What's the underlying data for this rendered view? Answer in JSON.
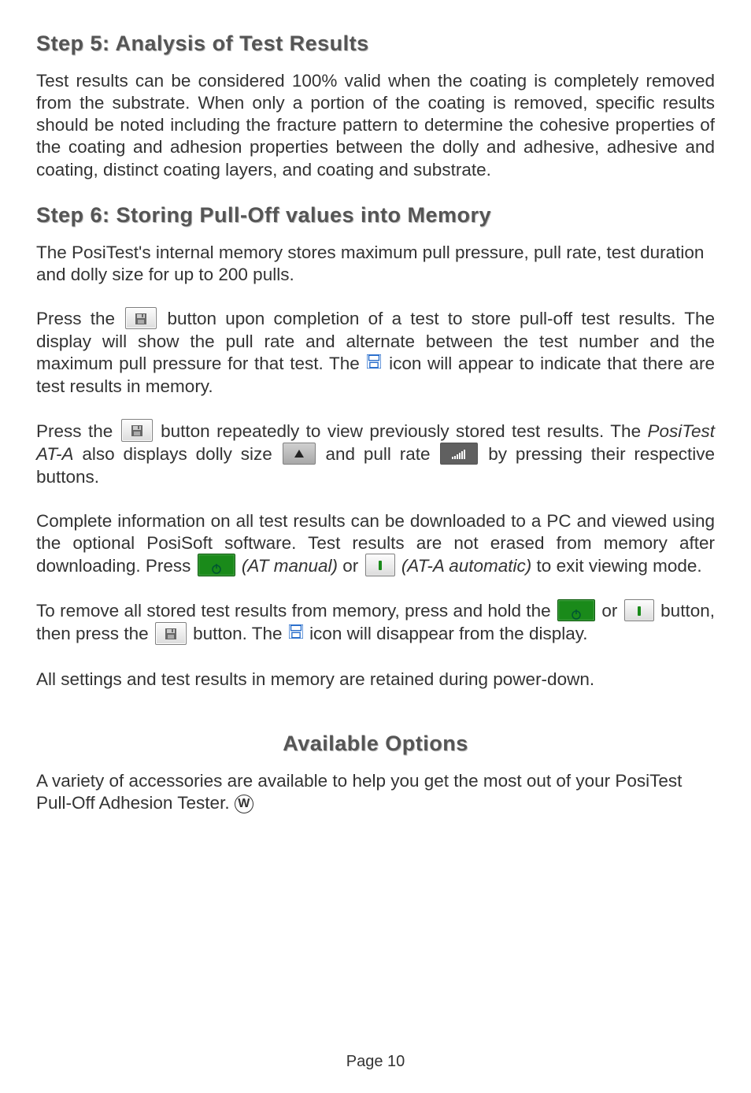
{
  "step5": {
    "heading": "Step 5: Analysis of Test Results",
    "text": "Test results can be considered 100% valid when the coating is completely removed from the substrate.  When only a portion of the coating is removed, specific results should be noted including the fracture pattern to determine the cohesive properties of the coating and adhesion properties between the dolly and adhesive, adhesive and coating, distinct coating layers, and coating and substrate."
  },
  "step6": {
    "heading": "Step 6: Storing Pull-Off values into Memory",
    "intro": "The PosiTest's internal memory stores maximum pull pressure, pull rate, test duration and dolly size for up to 200 pulls.",
    "p1_a": "Press the ",
    "p1_b": " button upon completion of a test to store pull-off test results. The display will show the pull rate and alternate between the test number and the maximum pull pressure for that test. The ",
    "p1_c": " icon will appear to indicate that there are test results in memory.",
    "p2_a": "Press the ",
    "p2_b": " button repeatedly to view previously stored test results. The ",
    "p2_italic": "PosiTest AT-A",
    "p2_c": " also displays dolly size ",
    "p2_d": " and pull rate ",
    "p2_e": " by pressing their respective buttons.",
    "p3_a": "Complete information on all test results can be downloaded to a PC and viewed using the optional PosiSoft software. Test results are not erased from memory after downloading. Press ",
    "p3_atmanual": "(AT manual)",
    "p3_b": " or ",
    "p3_atauto": "(AT-A automatic)",
    "p3_c": " to exit viewing mode.",
    "p4_a": "To remove all stored test results from memory, press and hold the ",
    "p4_b": " or ",
    "p4_c": " button, then press the ",
    "p4_d": " button. The ",
    "p4_e": " icon will disappear from the display.",
    "p5": "All settings and test results in memory are retained during power-down."
  },
  "options": {
    "heading": "Available Options",
    "text_a": "A variety of accessories are available to help you get the most out of your PosiTest Pull-Off Adhesion Tester.  ",
    "w": "W"
  },
  "footer": "Page 10"
}
